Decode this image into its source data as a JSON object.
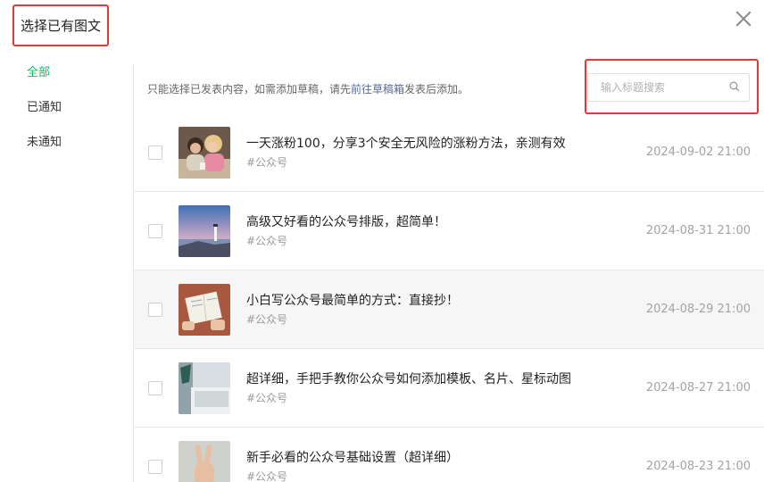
{
  "dialog": {
    "title": "选择已有图文"
  },
  "sidebar": {
    "items": [
      {
        "label": "全部"
      },
      {
        "label": "已通知"
      },
      {
        "label": "未通知"
      }
    ]
  },
  "hint": {
    "before": "只能选择已发表内容，如需添加草稿，请先",
    "link": "前往草稿箱",
    "after": "发表后添加。"
  },
  "search": {
    "placeholder": "输入标题搜索",
    "value": ""
  },
  "articles": [
    {
      "title": "一天涨粉100，分享3个安全无风险的涨粉方法，亲测有效",
      "tag": "#公众号",
      "date": "2024-09-02 21:00"
    },
    {
      "title": "高级又好看的公众号排版，超简单！",
      "tag": "#公众号",
      "date": "2024-08-31 21:00"
    },
    {
      "title": "小白写公众号最简单的方式：直接抄！",
      "tag": "#公众号",
      "date": "2024-08-29 21:00"
    },
    {
      "title": "超详细，手把手教你公众号如何添加模板、名片、星标动图",
      "tag": "#公众号",
      "date": "2024-08-27 21:00"
    },
    {
      "title": "新手必看的公众号基础设置（超详细）",
      "tag": "#公众号",
      "date": "2024-08-23 21:00"
    }
  ],
  "colors": {
    "accent": "#07c160",
    "link": "#576b95",
    "highlight": "#e53935",
    "hover_row": "#f6f6f6"
  }
}
